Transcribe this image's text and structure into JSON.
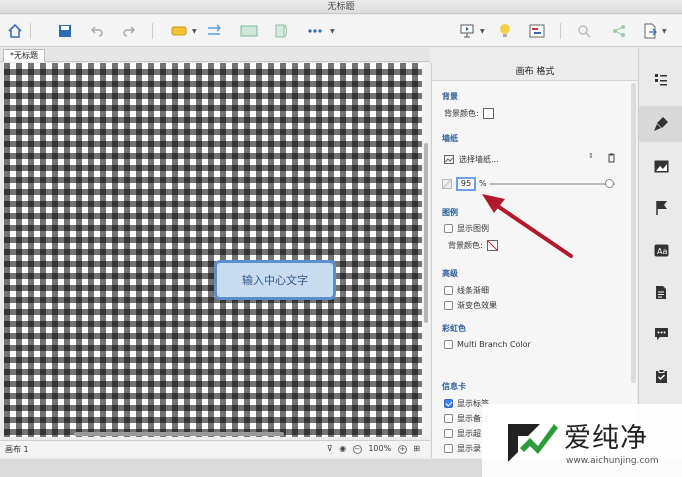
{
  "window": {
    "title": "无标题"
  },
  "document": {
    "tab_label": "*无标题"
  },
  "canvas": {
    "central_topic": "输入中心文字",
    "sheet_label": "画布 1",
    "zoom": "100%"
  },
  "format_panel": {
    "title": "画布 格式",
    "background": {
      "heading": "背景",
      "color_label": "背景颜色:"
    },
    "wallpaper": {
      "heading": "墙纸",
      "select_label": "选择墙纸...",
      "opacity_value": "95",
      "opacity_unit": "%",
      "opacity_level": 0.95
    },
    "legend": {
      "heading": "图例",
      "show_legend": "显示图例",
      "color_label": "背景颜色:"
    },
    "advanced": {
      "heading": "高级",
      "line_taper": "线条渐细",
      "gradient": "渐变色效果"
    },
    "rainbow": {
      "heading": "彩虹色",
      "multi_branch": "Multi Branch Color"
    },
    "info_card": {
      "heading": "信息卡",
      "show_labels": "显示标签",
      "show_notes": "显示备注",
      "show_hyperlinks": "显示超",
      "show_audio": "显示录"
    }
  },
  "watermark": {
    "brand": "爱纯净",
    "url": "www.aichunjing.com"
  },
  "colors": {
    "accent": "#2d5f99",
    "topic_fill": "#c9dbf1",
    "topic_border": "#5b8ed1",
    "annotation_arrow": "#b3192a",
    "watermark_green": "#2a9d3a"
  }
}
